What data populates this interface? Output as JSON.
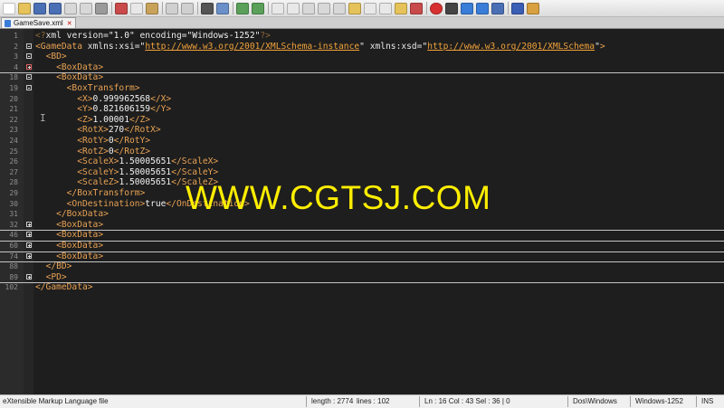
{
  "tab": {
    "label": "GameSave.xml"
  },
  "watermark": "WWW.CGTSJ.COM",
  "lines": [
    {
      "n": "1",
      "parts": [
        [
          "pi",
          "<?"
        ],
        [
          "attr",
          "xml version="
        ],
        [
          "val",
          "\"1.0\" "
        ],
        [
          "attr",
          "encoding="
        ],
        [
          "val",
          "\"Windows-1252\""
        ],
        [
          "pi",
          "?>"
        ]
      ]
    },
    {
      "n": "2",
      "parts": [
        [
          "tag",
          "<GameData "
        ],
        [
          "attr",
          "xmlns:xsi="
        ],
        [
          "val",
          "\""
        ],
        [
          "url",
          "http://www.w3.org/2001/XMLSchema-instance"
        ],
        [
          "val",
          "\" "
        ],
        [
          "attr",
          "xmlns:xsd="
        ],
        [
          "val",
          "\""
        ],
        [
          "url",
          "http://www.w3.org/2001/XMLSchema"
        ],
        [
          "val",
          "\""
        ],
        [
          "tag",
          ">"
        ]
      ]
    },
    {
      "n": "3",
      "parts": [
        [
          "txt",
          "  "
        ],
        [
          "tag",
          "<BD>"
        ]
      ]
    },
    {
      "n": "4",
      "parts": [
        [
          "txt",
          "    "
        ],
        [
          "tag",
          "<BoxData>"
        ]
      ]
    },
    {
      "n": "18",
      "parts": [
        [
          "txt",
          "    "
        ],
        [
          "tag",
          "<BoxData>"
        ]
      ]
    },
    {
      "n": "19",
      "parts": [
        [
          "txt",
          "      "
        ],
        [
          "tag",
          "<BoxTransform>"
        ]
      ]
    },
    {
      "n": "20",
      "parts": [
        [
          "txt",
          "        "
        ],
        [
          "tag",
          "<X>"
        ],
        [
          "txt",
          "0.999962568"
        ],
        [
          "tag",
          "</X>"
        ]
      ]
    },
    {
      "n": "21",
      "parts": [
        [
          "txt",
          "        "
        ],
        [
          "tag",
          "<Y>"
        ],
        [
          "txt",
          "0.821606159"
        ],
        [
          "tag",
          "</Y>"
        ]
      ]
    },
    {
      "n": "22",
      "parts": [
        [
          "txt",
          "        "
        ],
        [
          "tag",
          "<Z>"
        ],
        [
          "txt",
          "1.00001"
        ],
        [
          "tag",
          "</Z>"
        ]
      ]
    },
    {
      "n": "23",
      "parts": [
        [
          "txt",
          "        "
        ],
        [
          "tag",
          "<RotX>"
        ],
        [
          "txt",
          "270"
        ],
        [
          "tag",
          "</RotX>"
        ]
      ]
    },
    {
      "n": "24",
      "parts": [
        [
          "txt",
          "        "
        ],
        [
          "tag",
          "<RotY>"
        ],
        [
          "txt",
          "0"
        ],
        [
          "tag",
          "</RotY>"
        ]
      ]
    },
    {
      "n": "25",
      "parts": [
        [
          "txt",
          "        "
        ],
        [
          "tag",
          "<RotZ>"
        ],
        [
          "txt",
          "0"
        ],
        [
          "tag",
          "</RotZ>"
        ]
      ]
    },
    {
      "n": "26",
      "parts": [
        [
          "txt",
          "        "
        ],
        [
          "tag",
          "<ScaleX>"
        ],
        [
          "txt",
          "1.50005651"
        ],
        [
          "tag",
          "</ScaleX>"
        ]
      ]
    },
    {
      "n": "27",
      "parts": [
        [
          "txt",
          "        "
        ],
        [
          "tag",
          "<ScaleY>"
        ],
        [
          "txt",
          "1.50005651"
        ],
        [
          "tag",
          "</ScaleY>"
        ]
      ]
    },
    {
      "n": "28",
      "parts": [
        [
          "txt",
          "        "
        ],
        [
          "tag",
          "<ScaleZ>"
        ],
        [
          "txt",
          "1.50005651"
        ],
        [
          "tag",
          "</ScaleZ>"
        ]
      ]
    },
    {
      "n": "29",
      "parts": [
        [
          "txt",
          "      "
        ],
        [
          "tag",
          "</BoxTransform>"
        ]
      ]
    },
    {
      "n": "30",
      "parts": [
        [
          "txt",
          "      "
        ],
        [
          "tag",
          "<OnDestination>"
        ],
        [
          "txt",
          "true"
        ],
        [
          "tag",
          "</OnDestination>"
        ]
      ]
    },
    {
      "n": "31",
      "parts": [
        [
          "txt",
          "    "
        ],
        [
          "tag",
          "</BoxData>"
        ]
      ]
    },
    {
      "n": "32",
      "parts": [
        [
          "txt",
          "    "
        ],
        [
          "tag",
          "<BoxData>"
        ]
      ]
    },
    {
      "n": "46",
      "parts": [
        [
          "txt",
          "    "
        ],
        [
          "tag",
          "<BoxData>"
        ]
      ]
    },
    {
      "n": "60",
      "parts": [
        [
          "txt",
          "    "
        ],
        [
          "tag",
          "<BoxData>"
        ]
      ]
    },
    {
      "n": "74",
      "parts": [
        [
          "txt",
          "    "
        ],
        [
          "tag",
          "<BoxData>"
        ]
      ]
    },
    {
      "n": "88",
      "parts": [
        [
          "txt",
          "  "
        ],
        [
          "tag",
          "</BD>"
        ]
      ]
    },
    {
      "n": "89",
      "parts": [
        [
          "txt",
          "  "
        ],
        [
          "tag",
          "<PD>"
        ]
      ]
    },
    {
      "n": "102",
      "parts": [
        [
          "tag",
          "</GameData>"
        ]
      ]
    }
  ],
  "status": {
    "filetype": "eXtensible Markup Language file",
    "length": "length : 2774",
    "lines": "lines : 102",
    "position": "Ln : 16    Col : 43    Sel : 36 | 0",
    "eol": "Dos\\Windows",
    "encoding": "Windows-1252",
    "mode": "INS"
  }
}
